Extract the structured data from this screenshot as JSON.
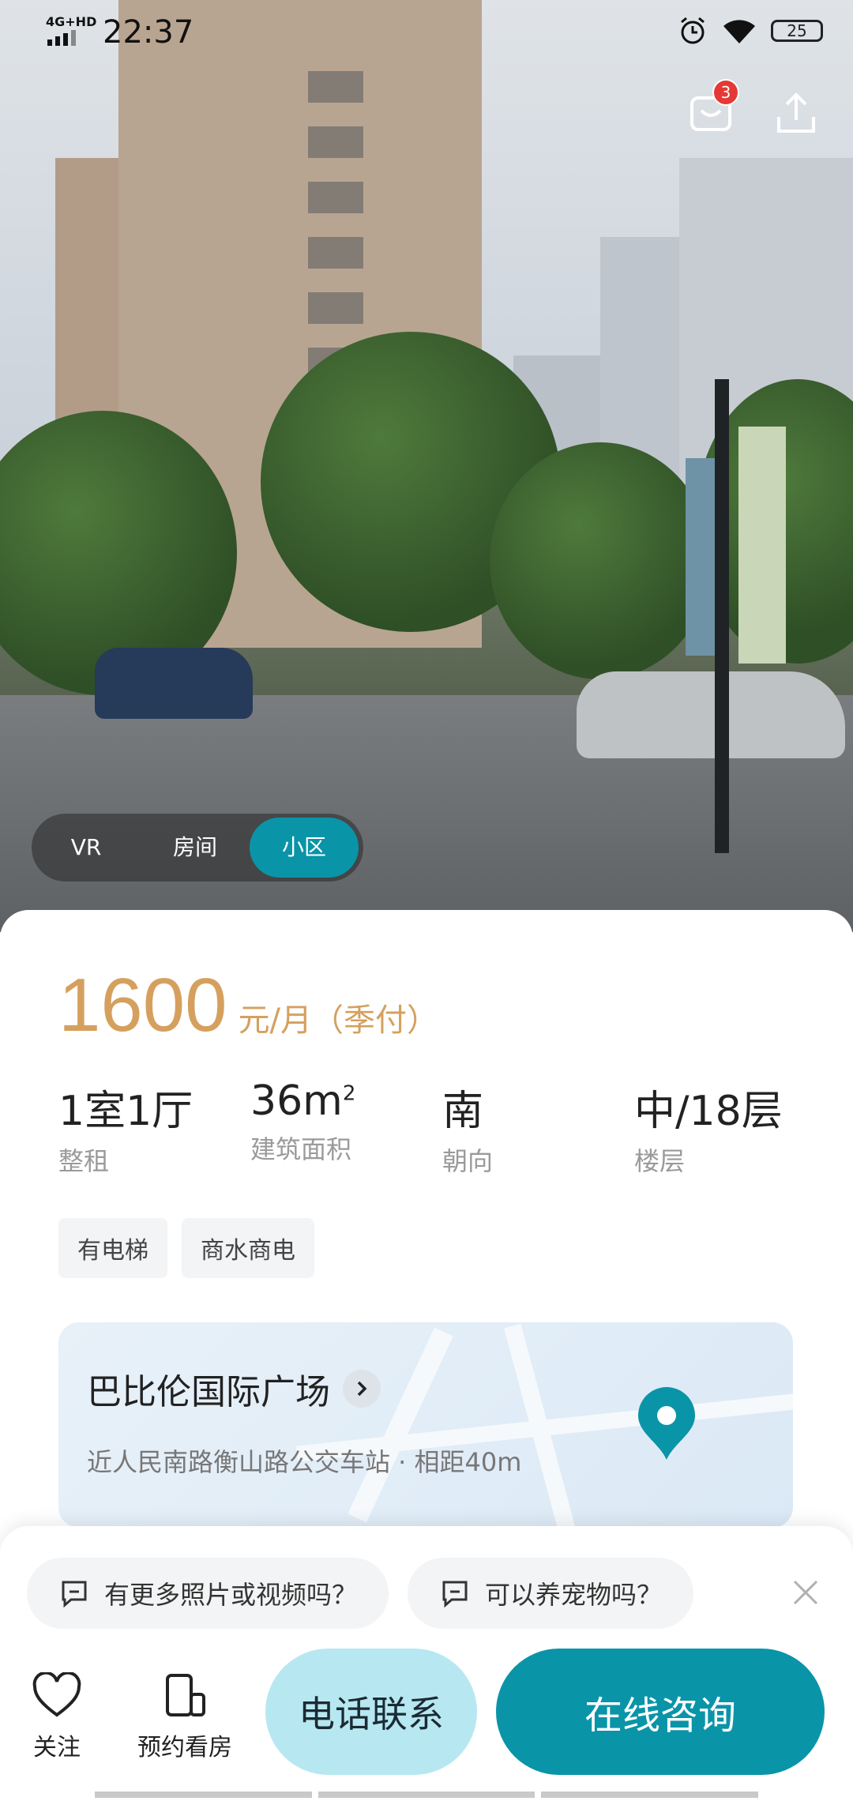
{
  "status_bar": {
    "network": "4G+HD",
    "time": "22:37",
    "battery": "25"
  },
  "header": {
    "message_badge": "3"
  },
  "media_tabs": [
    {
      "label": "VR",
      "active": false
    },
    {
      "label": "房间",
      "active": false
    },
    {
      "label": "小区",
      "active": true
    }
  ],
  "listing": {
    "price": "1600",
    "price_unit": "元/月（季付）",
    "facts": [
      {
        "value": "1室1厅",
        "label": "整租"
      },
      {
        "value": "36m",
        "sup": "2",
        "label": "建筑面积"
      },
      {
        "value": "南",
        "label": "朝向"
      },
      {
        "value": "中/18层",
        "label": "楼层"
      }
    ],
    "tags": [
      "有电梯",
      "商水商电"
    ]
  },
  "community": {
    "name": "巴比伦国际广场",
    "transit": "近人民南路衡山路公交车站 · 相距40m"
  },
  "quick_questions": [
    "有更多照片或视频吗？",
    "可以养宠物吗？"
  ],
  "bottom_bar": {
    "follow_label": "关注",
    "schedule_label": "预约看房",
    "call_label": "电话联系",
    "chat_label": "在线咨询"
  },
  "colors": {
    "accent": "#0a94a8",
    "price": "#d5a05e",
    "call_bg": "#b7e8f1",
    "badge": "#e53935"
  }
}
